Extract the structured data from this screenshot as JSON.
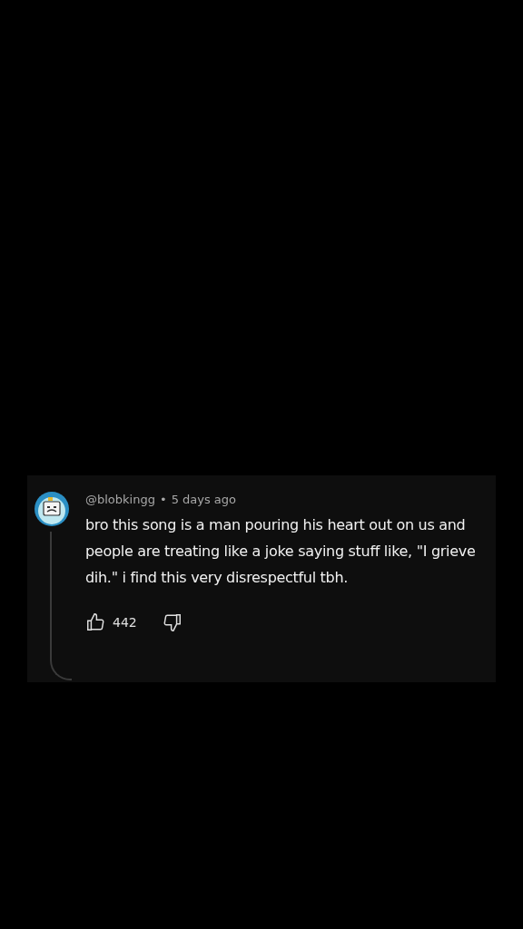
{
  "comment": {
    "author": "@blobkingg",
    "separator": "•",
    "time": "5 days ago",
    "text": "bro this song is a man pouring his heart out on us and people are treating like a joke saying stuff like, \"I grieve dih.\" i find this very disrespectful tbh.",
    "likes": "442",
    "liked": false,
    "disliked": false
  }
}
